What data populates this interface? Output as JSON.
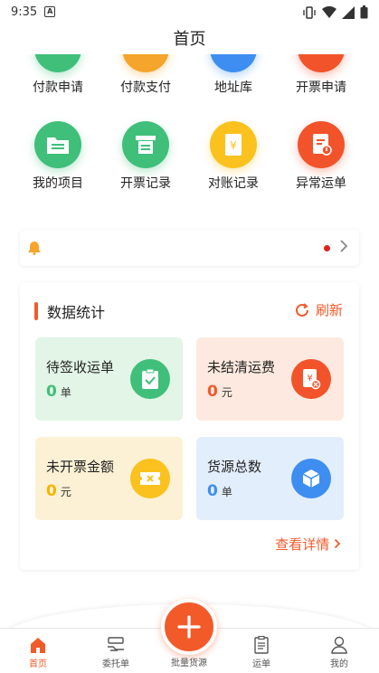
{
  "status_bar": {
    "time": "9:35",
    "notif_glyph": "A"
  },
  "header": {
    "title": "首页"
  },
  "grid": {
    "row1": [
      {
        "label": "付款申请",
        "icon": "payment-apply-icon",
        "color": "#3fbf7a"
      },
      {
        "label": "付款支付",
        "icon": "payment-pay-icon",
        "color": "#f5a52b"
      },
      {
        "label": "地址库",
        "icon": "address-book-icon",
        "color": "#3d8ef0"
      },
      {
        "label": "开票申请",
        "icon": "invoice-apply-icon",
        "color": "#f2532a"
      }
    ],
    "row2": [
      {
        "label": "我的项目",
        "icon": "folder-icon",
        "color": "#3fbf7a"
      },
      {
        "label": "开票记录",
        "icon": "printer-icon",
        "color": "#3fbf7a"
      },
      {
        "label": "对账记录",
        "icon": "yuan-notebook-icon",
        "color": "#fbc21f"
      },
      {
        "label": "异常运单",
        "icon": "exception-doc-icon",
        "color": "#f2532a"
      }
    ]
  },
  "stats": {
    "title": "数据统计",
    "refresh": "刷新",
    "detail": "查看详情",
    "cards": [
      {
        "title": "待签收运单",
        "value": "0",
        "unit": "单",
        "bg": "#e2f5e6",
        "value_color": "#3fbf7a",
        "icon": "clipboard-check-icon",
        "icon_color": "#3fbf7a"
      },
      {
        "title": "未结清运费",
        "value": "0",
        "unit": "元",
        "bg": "#fde9df",
        "value_color": "#f25a2a",
        "icon": "yuan-close-icon",
        "icon_color": "#f2532a"
      },
      {
        "title": "未开票金额",
        "value": "0",
        "unit": "元",
        "bg": "#fdf1d5",
        "value_color": "#f5b400",
        "icon": "ticket-icon",
        "icon_color": "#fbc21f"
      },
      {
        "title": "货源总数",
        "value": "0",
        "unit": "单",
        "bg": "#e3eefc",
        "value_color": "#3d8ef0",
        "icon": "cube-icon",
        "icon_color": "#3d8ef0"
      }
    ]
  },
  "tabbar": {
    "tabs": [
      {
        "label": "首页",
        "active": true
      },
      {
        "label": "委托单",
        "active": false
      },
      {
        "label": "批量货源",
        "active": false
      },
      {
        "label": "运单",
        "active": false
      },
      {
        "label": "我的",
        "active": false
      }
    ]
  }
}
